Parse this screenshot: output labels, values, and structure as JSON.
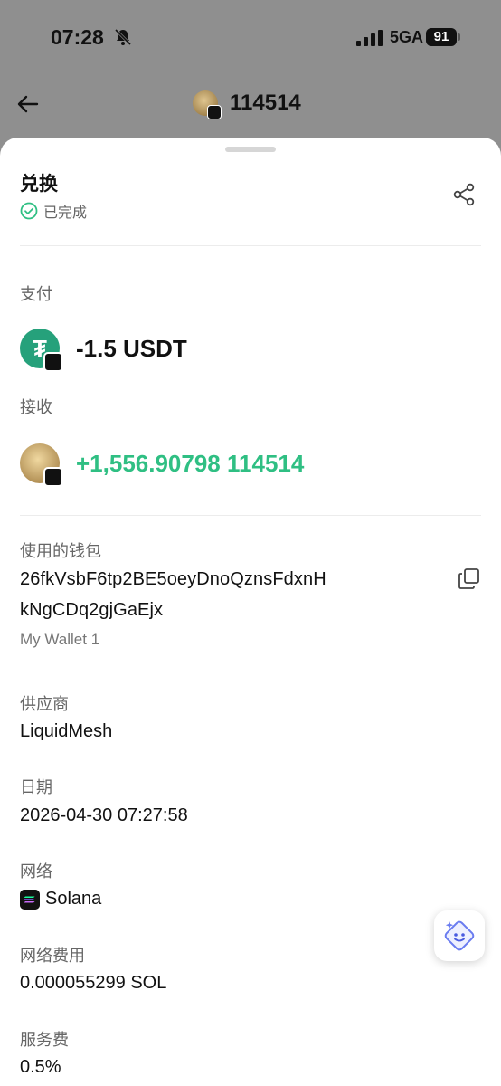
{
  "status_bar": {
    "time": "07:28",
    "network": "5GA",
    "battery": "91"
  },
  "nav": {
    "title": "114514"
  },
  "sheet": {
    "title": "兑换",
    "status": "已完成",
    "pay": {
      "label": "支付",
      "amount": "-1.5 USDT",
      "icon": "usdt-icon",
      "symbol": "₮"
    },
    "receive": {
      "label": "接收",
      "amount": "+1,556.90798 114514",
      "color": "#2fbf83"
    },
    "wallet": {
      "label": "使用的钱包",
      "address_line1": "26fkVsbF6tp2BE5oeyDnoQznsFdxnH",
      "address_line2": "kNgCDq2gjGaEjx",
      "name": "My Wallet 1"
    },
    "provider": {
      "label": "供应商",
      "value": "LiquidMesh"
    },
    "date": {
      "label": "日期",
      "value": "2026-04-30 07:27:58"
    },
    "network": {
      "label": "网络",
      "value": "Solana"
    },
    "network_fee": {
      "label": "网络费用",
      "value": "0.000055299 SOL"
    },
    "service_fee": {
      "label": "服务费",
      "value": "0.5%"
    }
  },
  "colors": {
    "success": "#2fbf83",
    "usdt": "#26a17b",
    "overlay": "#8f8f8f"
  }
}
